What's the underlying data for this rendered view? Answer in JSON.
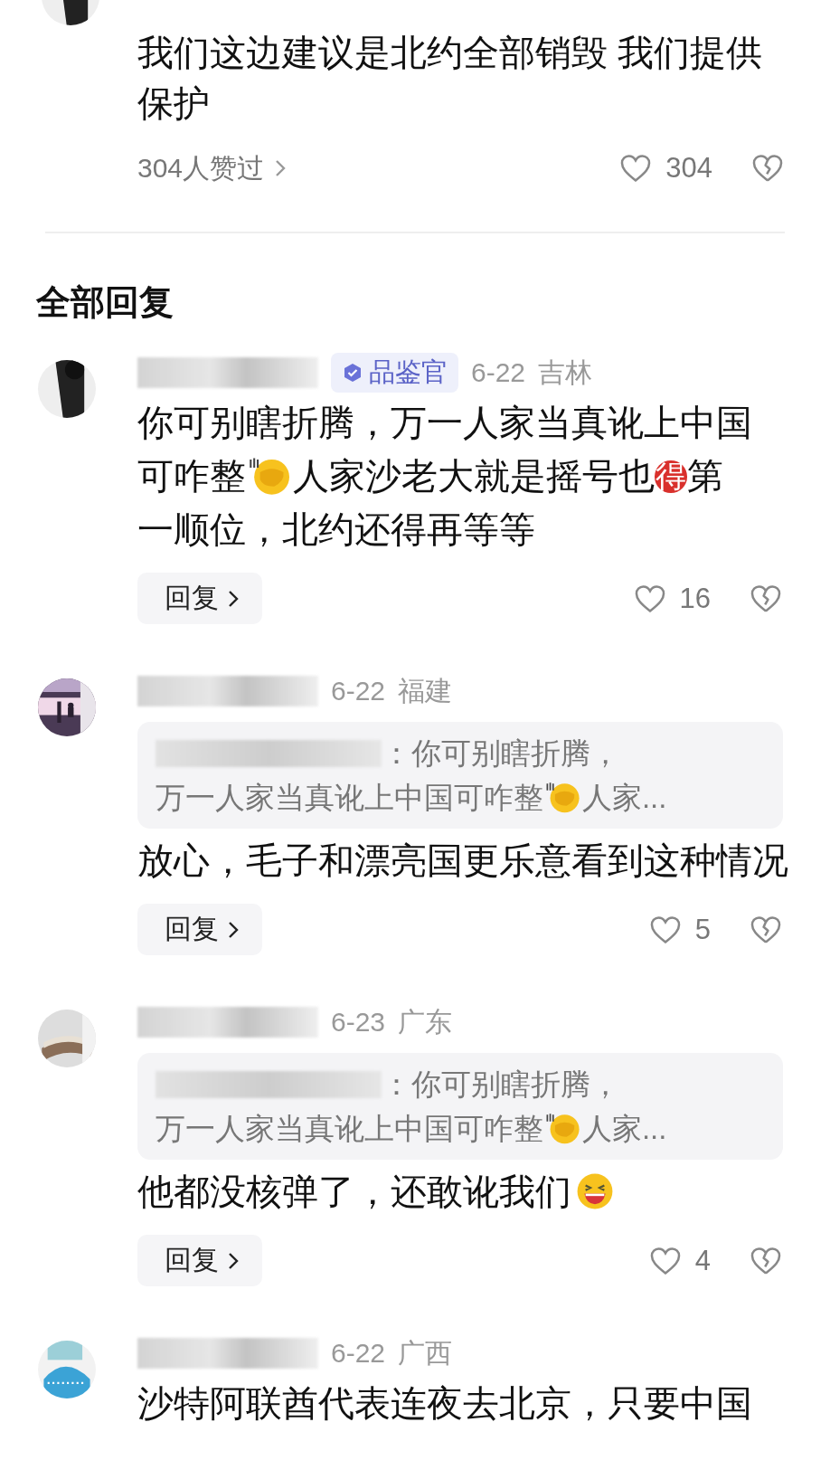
{
  "top_comment": {
    "body": [
      {
        "kind": "text",
        "text": "我们这边建议是北约全部销毁 我们提供保护"
      }
    ],
    "likers": "304人赞过",
    "likes": "304"
  },
  "section_title": "全部回复",
  "comments": [
    {
      "badge": "品鉴官",
      "date": "6-22",
      "location": "吉林",
      "body": [
        {
          "kind": "text",
          "text": "你可别瞎折腾，万一人家当真讹上中国"
        },
        {
          "kind": "text",
          "text": "可咋整"
        },
        {
          "kind": "facepalm"
        },
        {
          "kind": "text",
          "text": "人家沙老大就是摇号也"
        },
        {
          "kind": "badge",
          "text": "得"
        },
        {
          "kind": "text",
          "text": "第"
        },
        {
          "kind": "text",
          "text": "一顺位，北约还得再等等"
        }
      ],
      "reply_button": "回复",
      "likes": "16"
    },
    {
      "date": "6-22",
      "location": "福建",
      "quote_lines": [
        [
          {
            "kind": "blur"
          },
          {
            "kind": "text",
            "text": "：你可别瞎折腾，"
          }
        ],
        [
          {
            "kind": "text",
            "text": "万一人家当真讹上中国可咋整"
          },
          {
            "kind": "facepalm"
          },
          {
            "kind": "text",
            "text": "人家..."
          }
        ]
      ],
      "body": [
        {
          "kind": "text",
          "text": "放心，毛子和漂亮国更乐意看到这种情况"
        }
      ],
      "reply_button": "回复",
      "likes": "5"
    },
    {
      "date": "6-23",
      "location": "广东",
      "quote_lines": [
        [
          {
            "kind": "blur"
          },
          {
            "kind": "text",
            "text": "：你可别瞎折腾，"
          }
        ],
        [
          {
            "kind": "text",
            "text": "万一人家当真讹上中国可咋整"
          },
          {
            "kind": "facepalm"
          },
          {
            "kind": "text",
            "text": "人家..."
          }
        ]
      ],
      "body": [
        {
          "kind": "text",
          "text": "他都没核弹了，还敢讹我们"
        },
        {
          "kind": "grin"
        }
      ],
      "reply_button": "回复",
      "likes": "4"
    },
    {
      "date": "6-22",
      "location": "广西",
      "body": [
        {
          "kind": "text",
          "text": "沙特阿联酋代表连夜去北京，只要中国"
        }
      ]
    }
  ]
}
